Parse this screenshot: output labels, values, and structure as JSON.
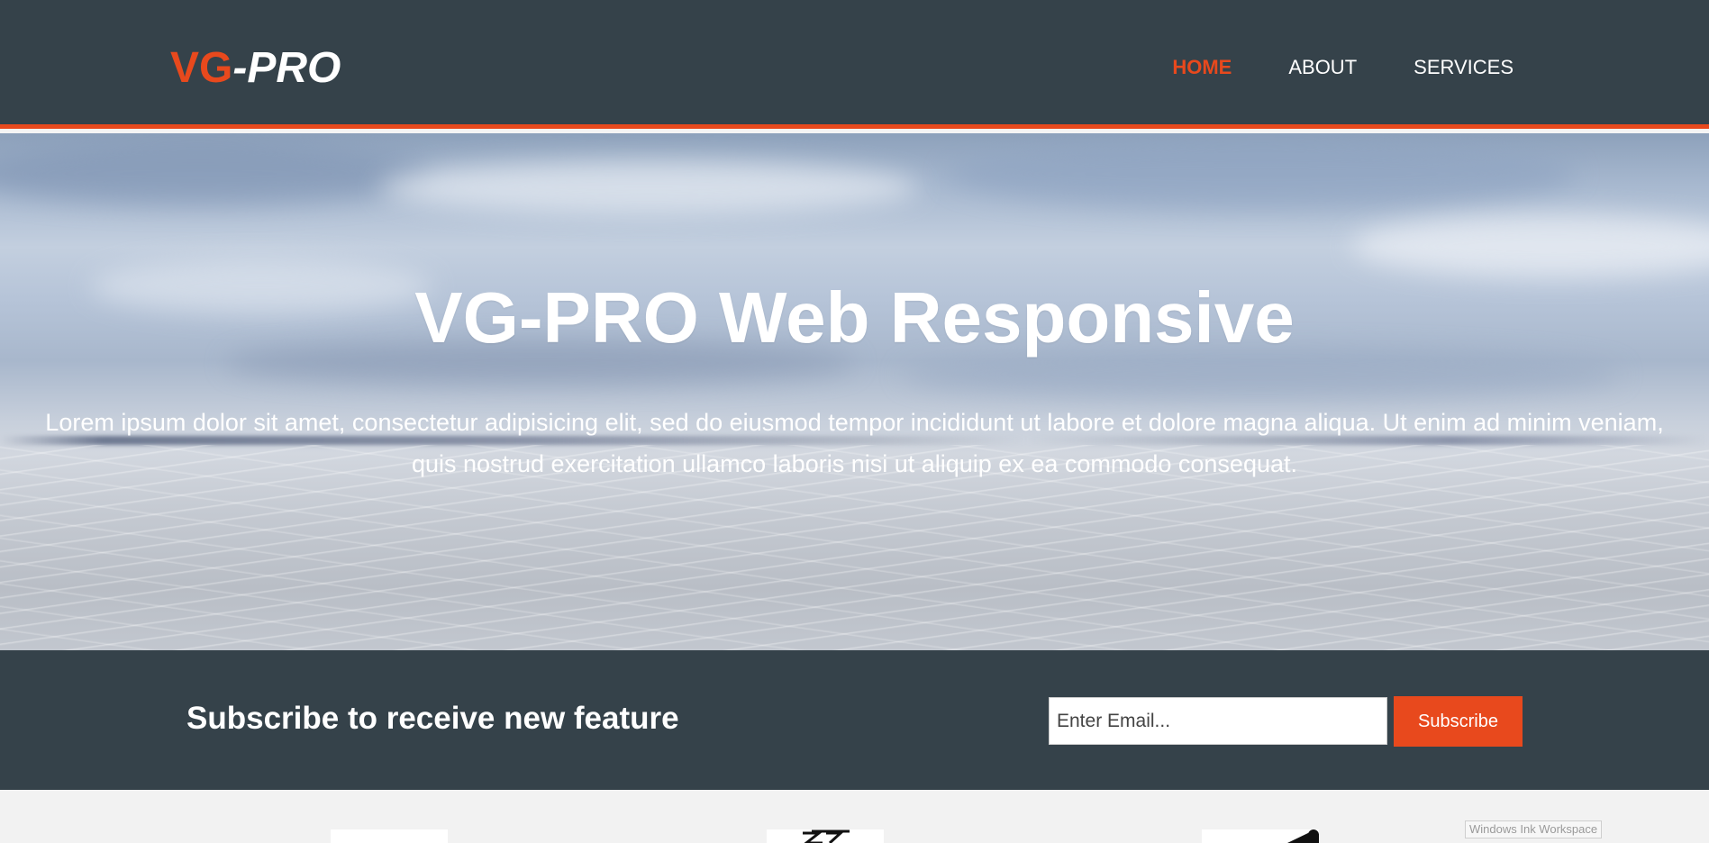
{
  "brand": {
    "accent_part": "VG",
    "rest_part": "-PRO",
    "accent_color": "#e8491d",
    "dark_color": "#35424a"
  },
  "nav": {
    "items": [
      {
        "label": "HOME",
        "active": true
      },
      {
        "label": "ABOUT",
        "active": false
      },
      {
        "label": "SERVICES",
        "active": false
      }
    ]
  },
  "showcase": {
    "title": "VG-PRO Web Responsive",
    "text": "Lorem ipsum dolor sit amet, consectetur adipisicing elit, sed do eiusmod tempor incididunt ut labore et dolore magna aliqua. Ut enim ad minim veniam, quis nostrud exercitation ullamco laboris nisi ut aliquip ex ea commodo consequat."
  },
  "newsletter": {
    "title": "Subscribe to receive new feature",
    "email_placeholder": "Enter Email...",
    "button_label": "Subscribe"
  },
  "boxes": {
    "icons": [
      "html-logo-icon",
      "css-logo-icon",
      "brush-logo-icon"
    ]
  },
  "tooltip": {
    "text": "Windows Ink Workspace"
  }
}
